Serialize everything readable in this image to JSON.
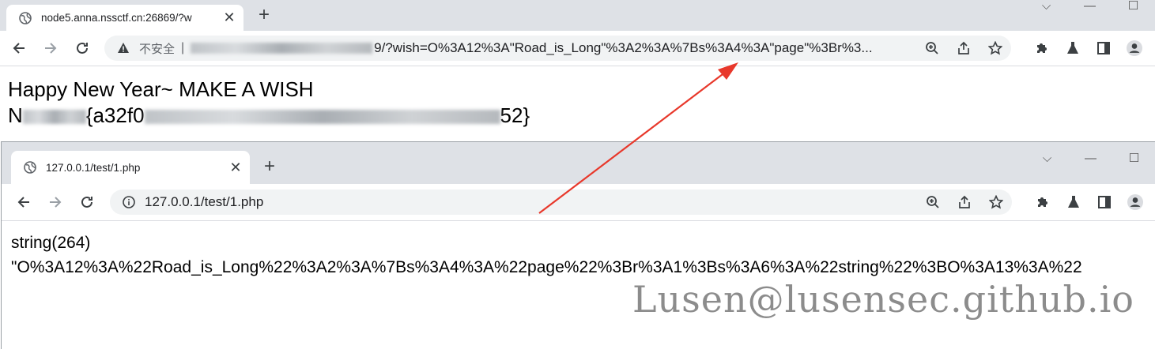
{
  "window1": {
    "tab_title": "node5.anna.nssctf.cn:26869/?w",
    "insecure_label": "不安全",
    "separator": "|",
    "url_visible": "9/?wish=O%3A12%3A\"Road_is_Long\"%3A2%3A%7Bs%3A4%3A\"page\"%3Br%3...",
    "content_line1": "Happy New Year~ MAKE A WISH",
    "content_line2_prefix": "N",
    "content_line2_mid": "{a32f0",
    "content_line2_suffix": "52}"
  },
  "window2": {
    "tab_title": "127.0.0.1/test/1.php",
    "url": "127.0.0.1/test/1.php",
    "content_line1": "string(264)",
    "content_line2": "\"O%3A12%3A%22Road_is_Long%22%3A2%3A%7Bs%3A4%3A%22page%22%3Br%3A1%3Bs%3A6%3A%22string%22%3BO%3A13%3A%22"
  },
  "watermark": "Lusen@lusensec.github.io",
  "icons": [
    "globe-icon",
    "close-icon",
    "plus-icon",
    "back-icon",
    "forward-icon",
    "reload-icon",
    "warning-icon",
    "info-icon",
    "zoom-icon",
    "share-icon",
    "star-icon",
    "puzzle-icon",
    "flask-icon",
    "sidepanel-icon",
    "profile-icon"
  ],
  "accent": "#e8382b"
}
